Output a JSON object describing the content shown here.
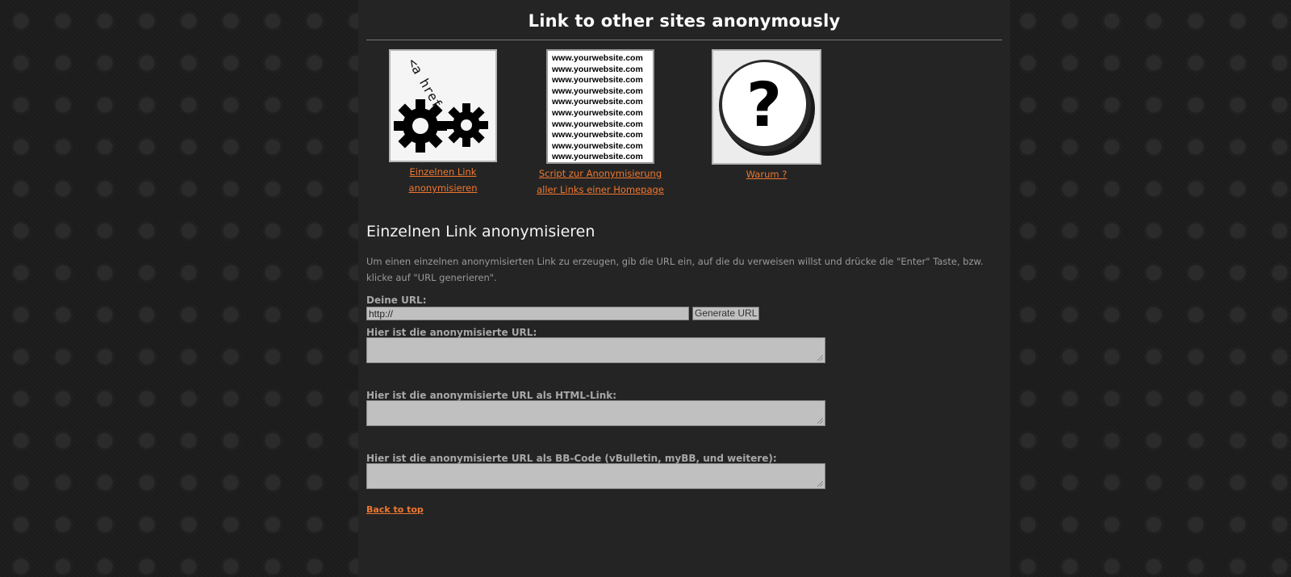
{
  "header": {
    "title": "Link to other sites anonymously"
  },
  "thumbs": [
    {
      "icon": "gears-code-icon",
      "code_text": "<a href",
      "link_line1": "Einzelnen Link",
      "link_line2": "anonymisieren"
    },
    {
      "icon": "website-list-icon",
      "list": [
        "www.yourwebsite.com",
        "www.yourwebsite.com",
        "www.yourwebsite.com",
        "www.yourwebsite.com",
        "www.yourwebsite.com",
        "www.yourwebsite.com",
        "www.yourwebsite.com",
        "www.yourwebsite.com",
        "www.yourwebsite.com",
        "www.yourwebsite.com"
      ],
      "link_line1": "Script zur Anonymisierung",
      "link_line2": "aller Links einer Homepage"
    },
    {
      "icon": "question-mark-icon",
      "symbol": "?",
      "link_line1": "Warum ?"
    }
  ],
  "section": {
    "heading": "Einzelnen Link anonymisieren",
    "description": "Um einen einzelnen anonymisierten Link zu erzeugen, gib die URL ein, auf die du verweisen willst und drücke die \"Enter\" Taste, bzw. klicke auf \"URL generieren\".",
    "url_label": "Deine URL:",
    "url_value": "http://",
    "generate_button": "Generate URL",
    "result_label": "Hier ist die anonymisierte URL:",
    "html_label": "Hier ist die anonymisierte URL als HTML-Link:",
    "bbcode_label": "Hier ist die anonymisierte URL als BB-Code (vBulletin, myBB, und weitere):",
    "back_to_top": "Back to top"
  },
  "colors": {
    "link": "#f0772f",
    "page_bg": "#242424",
    "field_bg": "#c0c0c0"
  }
}
